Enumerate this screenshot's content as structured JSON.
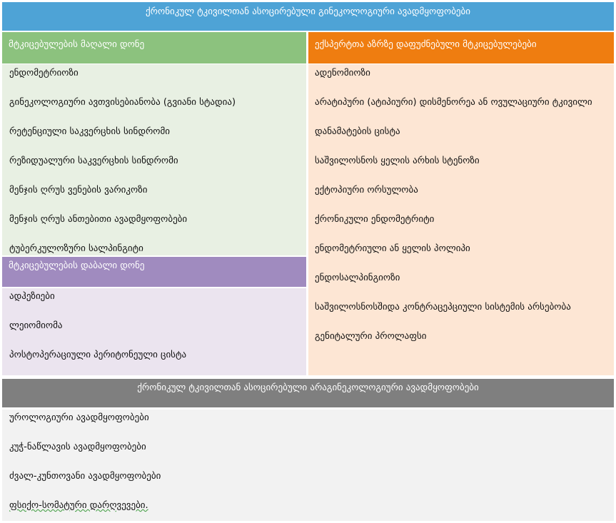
{
  "colors": {
    "main_header": "#4ea3d6",
    "high_level": "#8cc27e",
    "high_level_bg": "#e8f0e3",
    "expert": "#ef7d10",
    "expert_bg": "#fde6d4",
    "low_level": "#a08bbf",
    "low_level_bg": "#ebe4ef",
    "non_gyn_header": "#7f7f7f",
    "non_gyn_bg": "#f2f2f2"
  },
  "gyn_title": "ქრონიკულ ტკივილთან ასოცირებული გინეკოლოგიური ავადმყოფობები",
  "high_level": {
    "title": "მტკიცებულების მაღალი დონე",
    "items": [
      "ენდომეტრიოზი",
      "გინეკოლოგიური ავთვისებიანობა (გვიანი სტადია)",
      "რეტენციული საკვერცხის სინდრომი",
      "რეზიდუალური საკვერცხის სინდრომი",
      "მენჯის ღრუს ვენების ვარიკოზი",
      "მენჯის ღრუს ანთებითი ავადმყოფობები",
      "ტუბერკულოზური სალპინგიტი"
    ]
  },
  "low_level": {
    "title": "მტკიცებულების  დაბალი დონე",
    "items": [
      "ადჰეზიები",
      "ლეიომიომა",
      "პოსტოპერაციული პერიტონეული ცისტა"
    ]
  },
  "expert": {
    "title": "ექსპერტთა აზრზე დაფუძნებული მტკიცებულებები",
    "items": [
      "ადენომიოზი",
      "არატიპური (ატიპიური) დისმენორეა ან ოვულაციური ტკივილი",
      "დანამატების ცისტა",
      "საშვილოსნოს ყელის  არხის სტენოზი",
      "ექტოპიური ორსულობა",
      "ქრონიკული ენდომეტრიტი",
      "ენდომეტრიული ან ყელის პოლიპი",
      "ენდოსალპინგიოზი",
      "საშვილოსნოსშიდა კონტრაცეპციული სისტემის არსებობა",
      "გენიტალური პროლაფსი"
    ]
  },
  "non_gyn": {
    "title": "ქრონიკულ ტკივილთან ასოცირებული არაგინეკოლოგიური ავადმყოფობები",
    "items": [
      "უროლოგიური ავადმყოფობები",
      "კუჭ-ნაწლავის ავადმყოფობები",
      "ძვალ-კუნთოვანი ავადმყოფობები",
      "ფსიქო-სომატური დარღვევები."
    ]
  }
}
